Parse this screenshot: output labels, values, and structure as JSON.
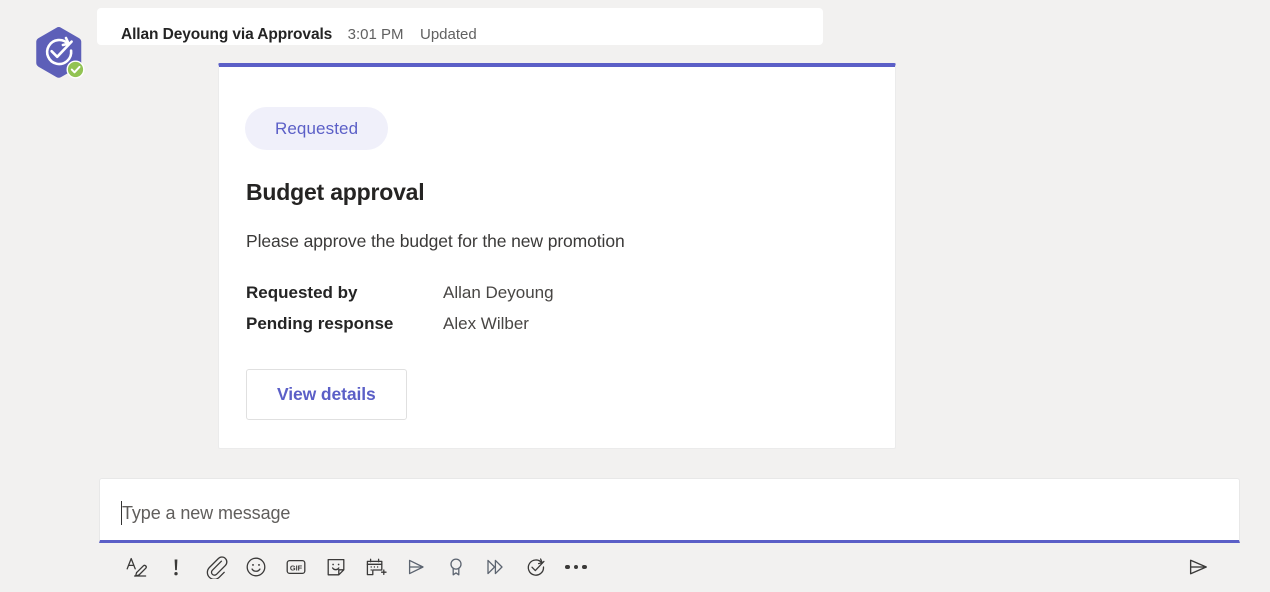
{
  "message": {
    "author": "Allan Deyoung via Approvals",
    "time": "3:01 PM",
    "status": "Updated",
    "avatar_icon": "approvals-app-avatar",
    "presence_icon": "available-check-badge"
  },
  "card": {
    "accent_color": "#5b5fc7",
    "status_badge": {
      "label": "Requested",
      "background": "#f0f0fa",
      "text_color": "#5b5fc7"
    },
    "title": "Budget approval",
    "description": "Please approve the budget for the new promotion",
    "facts": [
      {
        "label": "Requested by",
        "value": "Allan Deyoung"
      },
      {
        "label": "Pending response",
        "value": "Alex Wilber"
      }
    ],
    "action_button": {
      "label": "View details",
      "text_color": "#5b5fc7"
    }
  },
  "compose": {
    "placeholder": "Type a new message",
    "value": "",
    "focus_border_color": "#5b5fc7",
    "toolbar": [
      {
        "name": "format-icon",
        "title": "Format"
      },
      {
        "name": "important-icon",
        "title": "Set delivery options"
      },
      {
        "name": "attach-icon",
        "title": "Attach"
      },
      {
        "name": "emoji-icon",
        "title": "Emoji"
      },
      {
        "name": "gif-icon",
        "title": "Giphy",
        "label": "GIF"
      },
      {
        "name": "sticker-icon",
        "title": "Sticker"
      },
      {
        "name": "schedule-meeting-icon",
        "title": "Schedule a meeting"
      },
      {
        "name": "stream-icon",
        "title": "Stream"
      },
      {
        "name": "praise-icon",
        "title": "Praise"
      },
      {
        "name": "power-automate-icon",
        "title": "Power Automate"
      },
      {
        "name": "approvals-icon",
        "title": "Approvals"
      },
      {
        "name": "more-options-icon",
        "title": "More options"
      }
    ],
    "send": {
      "name": "send-icon",
      "title": "Send"
    }
  }
}
